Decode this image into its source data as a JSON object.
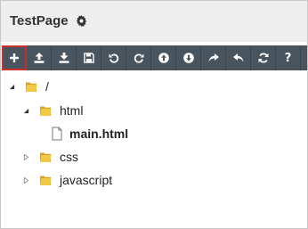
{
  "app": {
    "title": "TestPage",
    "settings_icon": "gear-icon"
  },
  "toolbar": {
    "buttons": [
      {
        "name": "new-button",
        "icon": "plus-icon",
        "active": true
      },
      {
        "name": "upload-button",
        "icon": "upload-icon"
      },
      {
        "name": "download-button",
        "icon": "download-icon"
      },
      {
        "name": "save-button",
        "icon": "save-icon"
      },
      {
        "name": "undo-button",
        "icon": "undo-icon"
      },
      {
        "name": "redo-button",
        "icon": "redo-icon"
      },
      {
        "name": "move-up-button",
        "icon": "arrow-up-circle-icon"
      },
      {
        "name": "move-down-button",
        "icon": "arrow-down-circle-icon"
      },
      {
        "name": "forward-button",
        "icon": "share-icon"
      },
      {
        "name": "reply-button",
        "icon": "reply-icon"
      },
      {
        "name": "refresh-button",
        "icon": "refresh-icon"
      },
      {
        "name": "help-button",
        "icon": "question-icon",
        "label": "?"
      }
    ],
    "accent": "#48545e",
    "active_border": "#c9302c"
  },
  "tree": {
    "root": {
      "label": "/",
      "expanded": true
    },
    "html": {
      "label": "html",
      "expanded": true
    },
    "main": {
      "label": "main.html"
    },
    "css": {
      "label": "css",
      "expanded": false
    },
    "javascript": {
      "label": "javascript",
      "expanded": false
    }
  },
  "colors": {
    "folder": "#e8b830",
    "titlebar_bg": "#eeeeee"
  }
}
